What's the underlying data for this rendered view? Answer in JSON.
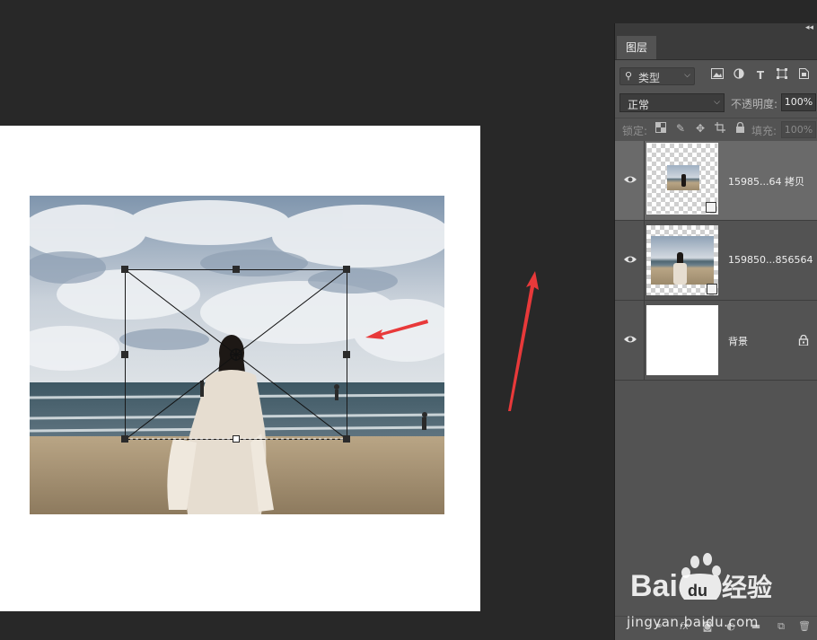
{
  "panel": {
    "tab_label": "图层",
    "filter_label": "类型",
    "blend_mode": "正常",
    "opacity_label": "不透明度:",
    "opacity_value": "100%",
    "lock_label": "锁定:",
    "fill_label": "填充:",
    "fill_value": "100%"
  },
  "layers": [
    {
      "name": "15985...64 拷贝",
      "selected": true,
      "visible": true
    },
    {
      "name": "159850...856564",
      "selected": false,
      "visible": true
    },
    {
      "name": "背景",
      "selected": false,
      "visible": true,
      "locked": true
    }
  ],
  "watermark": {
    "text": "jingyan.baidu.com",
    "brand": "Baidu经验"
  },
  "colors": {
    "annotation_arrow": "#e8393a",
    "panel_bg": "#535353",
    "canvas_bg": "#282828"
  }
}
